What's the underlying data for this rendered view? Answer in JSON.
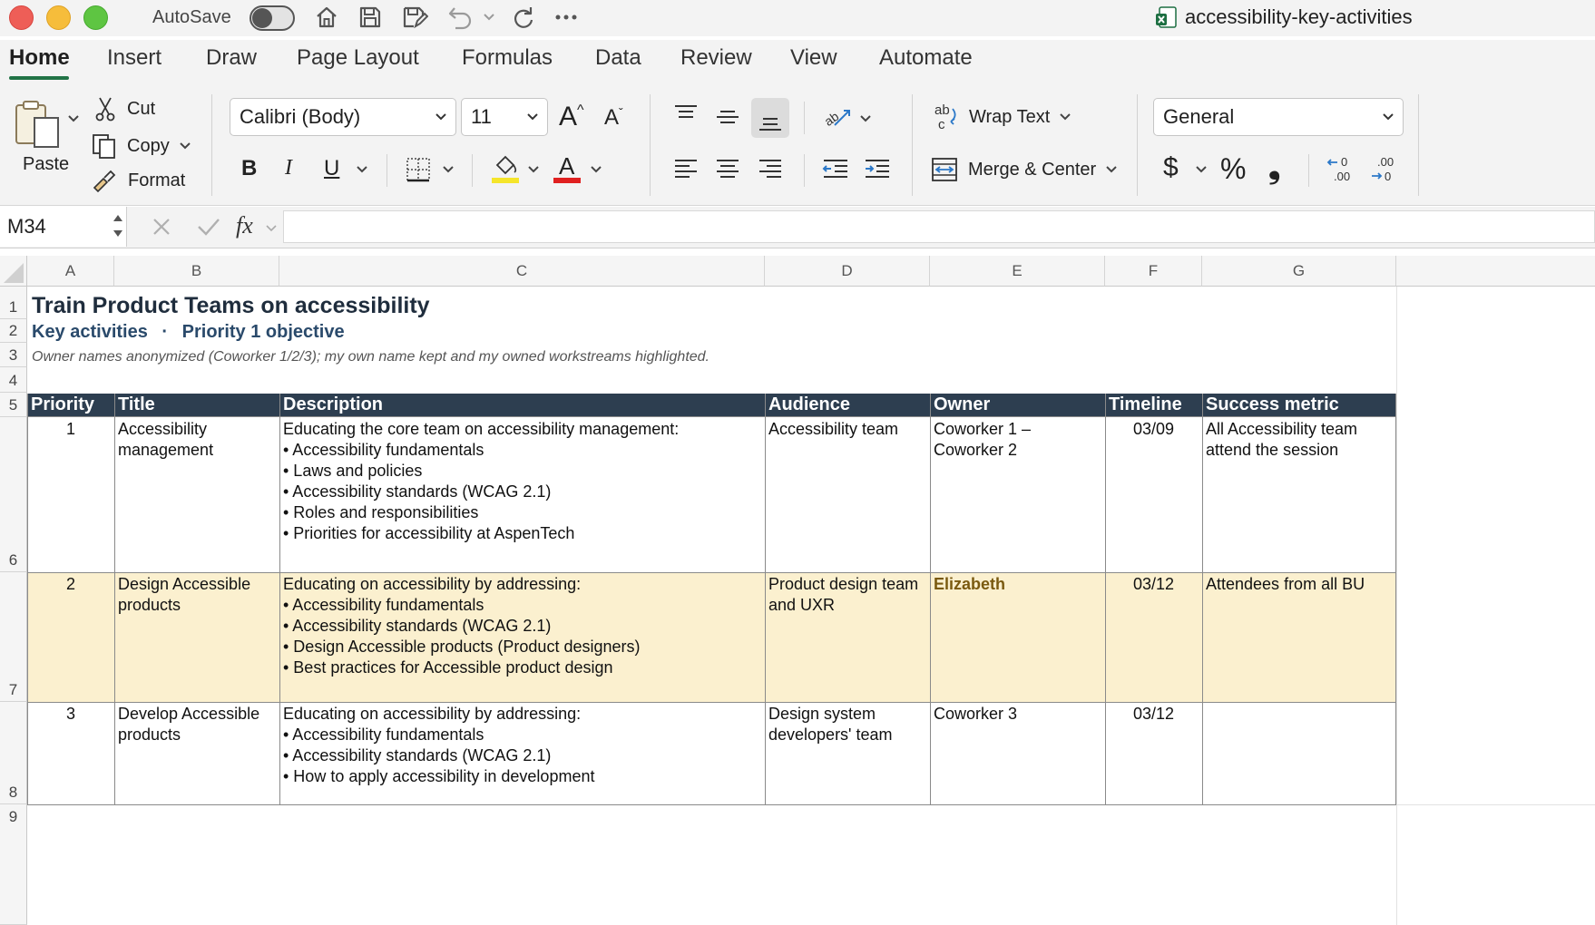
{
  "titlebar": {
    "autosave_label": "AutoSave",
    "document_title": "accessibility-key-activities"
  },
  "tabs": [
    {
      "label": "Home",
      "active": true
    },
    {
      "label": "Insert"
    },
    {
      "label": "Draw"
    },
    {
      "label": "Page Layout"
    },
    {
      "label": "Formulas"
    },
    {
      "label": "Data"
    },
    {
      "label": "Review"
    },
    {
      "label": "View"
    },
    {
      "label": "Automate"
    }
  ],
  "ribbon": {
    "paste_label": "Paste",
    "cut_label": "Cut",
    "copy_label": "Copy",
    "format_label": "Format",
    "font_name": "Calibri (Body)",
    "font_size": "11",
    "bold": "B",
    "italic": "I",
    "underline": "U",
    "wrap_text": "Wrap Text",
    "merge_center": "Merge & Center",
    "number_format": "General",
    "currency": "$",
    "percent": "%",
    "comma": "❟",
    "font_color_hex": "#e02020",
    "highlight_hex": "#f5e52a"
  },
  "formula_bar": {
    "name_box": "M34",
    "fx_label": "fx",
    "formula": ""
  },
  "columns": [
    "A",
    "B",
    "C",
    "D",
    "E",
    "F",
    "G"
  ],
  "rows": [
    "1",
    "2",
    "3",
    "4",
    "5",
    "6",
    "7",
    "8",
    "9"
  ],
  "sheet": {
    "title": "Train Product Teams on accessibility",
    "subtitle_left": "Key activities",
    "subtitle_sep": "·",
    "subtitle_right": "Priority 1 objective",
    "note": "Owner names anonymized (Coworker 1/2/3); my own name kept and my owned workstreams highlighted.",
    "headers": [
      "Priority",
      "Title",
      "Description",
      "Audience",
      "Owner",
      "Timeline",
      "Success metric"
    ],
    "header_bg": "#2d3e50",
    "highlight_row_bg": "#fbf0cf",
    "rows": [
      {
        "priority": "1",
        "title_lines": [
          "Accessibility",
          "management"
        ],
        "desc_lines": [
          "Educating the core team on accessibility management:",
          "• Accessibility fundamentals",
          "• Laws and policies",
          "• Accessibility standards (WCAG 2.1)",
          "• Roles and responsibilities",
          "• Priorities for accessibility at AspenTech"
        ],
        "audience_lines": [
          "Accessibility team"
        ],
        "owner_lines": [
          "Coworker 1 –",
          "Coworker 2"
        ],
        "timeline": "03/09",
        "metric_lines": [
          "All Accessibility team",
          "attend the session"
        ]
      },
      {
        "priority": "2",
        "title_lines": [
          "Design Accessible",
          "products"
        ],
        "desc_lines": [
          "Educating on accessibility by addressing:",
          "• Accessibility fundamentals",
          "• Accessibility standards (WCAG 2.1)",
          "• Design Accessible products (Product designers)",
          "• Best practices for Accessible product design"
        ],
        "audience_lines": [
          "Product design team",
          "and UXR"
        ],
        "owner_lines": [
          "Elizabeth"
        ],
        "timeline": "03/12",
        "metric_lines": [
          "Attendees from all BU"
        ]
      },
      {
        "priority": "3",
        "title_lines": [
          "Develop Accessible",
          "products"
        ],
        "desc_lines": [
          "Educating on accessibility by addressing:",
          "• Accessibility fundamentals",
          "• Accessibility standards (WCAG 2.1)",
          "• How to apply accessibility in development"
        ],
        "audience_lines": [
          "Design system",
          "developers' team"
        ],
        "owner_lines": [
          "Coworker 3"
        ],
        "timeline": "03/12",
        "metric_lines": []
      }
    ]
  }
}
